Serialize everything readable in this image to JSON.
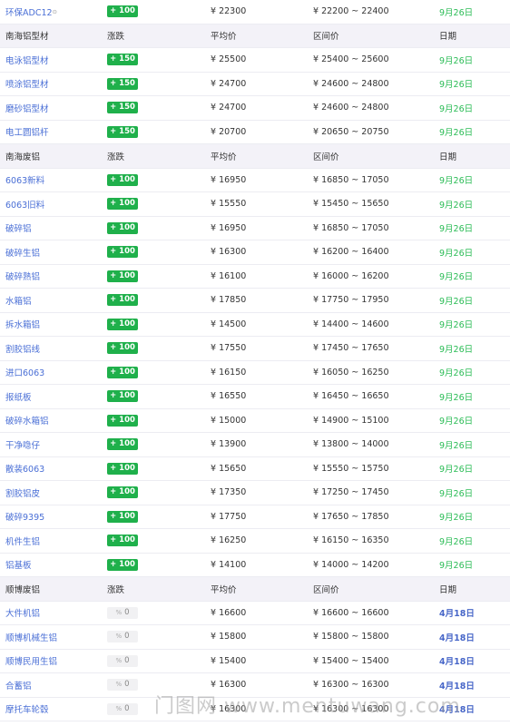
{
  "sections": [
    {
      "header": null,
      "rows": [
        {
          "name": "环保ADC12",
          "change": "+ 100",
          "trend": "up",
          "avg": "¥ 22300",
          "range": "¥ 22200 ~ 22400",
          "date": "9月26日",
          "date_style": "green"
        }
      ]
    },
    {
      "header": {
        "name": "南海铝型材",
        "change": "涨跌",
        "avg": "平均价",
        "range": "区间价",
        "date": "日期"
      },
      "rows": [
        {
          "name": "电泳铝型材",
          "change": "+ 150",
          "trend": "up",
          "avg": "¥ 25500",
          "range": "¥ 25400 ~ 25600",
          "date": "9月26日",
          "date_style": "green"
        },
        {
          "name": "喷涂铝型材",
          "change": "+ 150",
          "trend": "up",
          "avg": "¥ 24700",
          "range": "¥ 24600 ~ 24800",
          "date": "9月26日",
          "date_style": "green"
        },
        {
          "name": "磨砂铝型材",
          "change": "+ 150",
          "trend": "up",
          "avg": "¥ 24700",
          "range": "¥ 24600 ~ 24800",
          "date": "9月26日",
          "date_style": "green"
        },
        {
          "name": "电工圆铝杆",
          "change": "+ 150",
          "trend": "up",
          "avg": "¥ 20700",
          "range": "¥ 20650 ~ 20750",
          "date": "9月26日",
          "date_style": "green"
        }
      ]
    },
    {
      "header": {
        "name": "南海废铝",
        "change": "涨跌",
        "avg": "平均价",
        "range": "区间价",
        "date": "日期"
      },
      "rows": [
        {
          "name": "6063新料",
          "change": "+ 100",
          "trend": "up",
          "avg": "¥ 16950",
          "range": "¥ 16850 ~ 17050",
          "date": "9月26日",
          "date_style": "green"
        },
        {
          "name": "6063旧料",
          "change": "+ 100",
          "trend": "up",
          "avg": "¥ 15550",
          "range": "¥ 15450 ~ 15650",
          "date": "9月26日",
          "date_style": "green"
        },
        {
          "name": "破碎铝",
          "change": "+ 100",
          "trend": "up",
          "avg": "¥ 16950",
          "range": "¥ 16850 ~ 17050",
          "date": "9月26日",
          "date_style": "green"
        },
        {
          "name": "破碎生铝",
          "change": "+ 100",
          "trend": "up",
          "avg": "¥ 16300",
          "range": "¥ 16200 ~ 16400",
          "date": "9月26日",
          "date_style": "green"
        },
        {
          "name": "破碎熟铝",
          "change": "+ 100",
          "trend": "up",
          "avg": "¥ 16100",
          "range": "¥ 16000 ~ 16200",
          "date": "9月26日",
          "date_style": "green"
        },
        {
          "name": "水箱铝",
          "change": "+ 100",
          "trend": "up",
          "avg": "¥ 17850",
          "range": "¥ 17750 ~ 17950",
          "date": "9月26日",
          "date_style": "green"
        },
        {
          "name": "拆水箱铝",
          "change": "+ 100",
          "trend": "up",
          "avg": "¥ 14500",
          "range": "¥ 14400 ~ 14600",
          "date": "9月26日",
          "date_style": "green"
        },
        {
          "name": "割胶铝线",
          "change": "+ 100",
          "trend": "up",
          "avg": "¥ 17550",
          "range": "¥ 17450 ~ 17650",
          "date": "9月26日",
          "date_style": "green"
        },
        {
          "name": "进口6063",
          "change": "+ 100",
          "trend": "up",
          "avg": "¥ 16150",
          "range": "¥ 16050 ~ 16250",
          "date": "9月26日",
          "date_style": "green"
        },
        {
          "name": "报纸板",
          "change": "+ 100",
          "trend": "up",
          "avg": "¥ 16550",
          "range": "¥ 16450 ~ 16650",
          "date": "9月26日",
          "date_style": "green"
        },
        {
          "name": "破碎水箱铝",
          "change": "+ 100",
          "trend": "up",
          "avg": "¥ 15000",
          "range": "¥ 14900 ~ 15100",
          "date": "9月26日",
          "date_style": "green"
        },
        {
          "name": "干净喼仔",
          "change": "+ 100",
          "trend": "up",
          "avg": "¥ 13900",
          "range": "¥ 13800 ~ 14000",
          "date": "9月26日",
          "date_style": "green"
        },
        {
          "name": "散装6063",
          "change": "+ 100",
          "trend": "up",
          "avg": "¥ 15650",
          "range": "¥ 15550 ~ 15750",
          "date": "9月26日",
          "date_style": "green"
        },
        {
          "name": "割胶铝皮",
          "change": "+ 100",
          "trend": "up",
          "avg": "¥ 17350",
          "range": "¥ 17250 ~ 17450",
          "date": "9月26日",
          "date_style": "green"
        },
        {
          "name": "破碎9395",
          "change": "+ 100",
          "trend": "up",
          "avg": "¥ 17750",
          "range": "¥ 17650 ~ 17850",
          "date": "9月26日",
          "date_style": "green"
        },
        {
          "name": "机件生铝",
          "change": "+ 100",
          "trend": "up",
          "avg": "¥ 16250",
          "range": "¥ 16150 ~ 16350",
          "date": "9月26日",
          "date_style": "green"
        },
        {
          "name": "铝基板",
          "change": "+ 100",
          "trend": "up",
          "avg": "¥ 14100",
          "range": "¥ 14000 ~ 14200",
          "date": "9月26日",
          "date_style": "green"
        }
      ]
    },
    {
      "header": {
        "name": "顺博废铝",
        "change": "涨跌",
        "avg": "平均价",
        "range": "区间价",
        "date": "日期"
      },
      "rows": [
        {
          "name": "大件机铝",
          "change": "0",
          "trend": "flat",
          "avg": "¥ 16600",
          "range": "¥ 16600 ~ 16600",
          "date": "4月18日",
          "date_style": "blue"
        },
        {
          "name": "顺博机械生铝",
          "change": "0",
          "trend": "flat",
          "avg": "¥ 15800",
          "range": "¥ 15800 ~ 15800",
          "date": "4月18日",
          "date_style": "blue"
        },
        {
          "name": "顺博民用生铝",
          "change": "0",
          "trend": "flat",
          "avg": "¥ 15400",
          "range": "¥ 15400 ~ 15400",
          "date": "4月18日",
          "date_style": "blue"
        },
        {
          "name": "合蓄铝",
          "change": "0",
          "trend": "flat",
          "avg": "¥ 16300",
          "range": "¥ 16300 ~ 16300",
          "date": "4月18日",
          "date_style": "blue"
        },
        {
          "name": "摩托车轮毂",
          "change": "0",
          "trend": "flat",
          "avg": "¥ 16300",
          "range": "¥ 16300 ~ 16300",
          "date": "4月18日",
          "date_style": "blue"
        }
      ]
    }
  ],
  "watermark": "门图网 www.mentuwang.com",
  "flat_prefix": "%"
}
